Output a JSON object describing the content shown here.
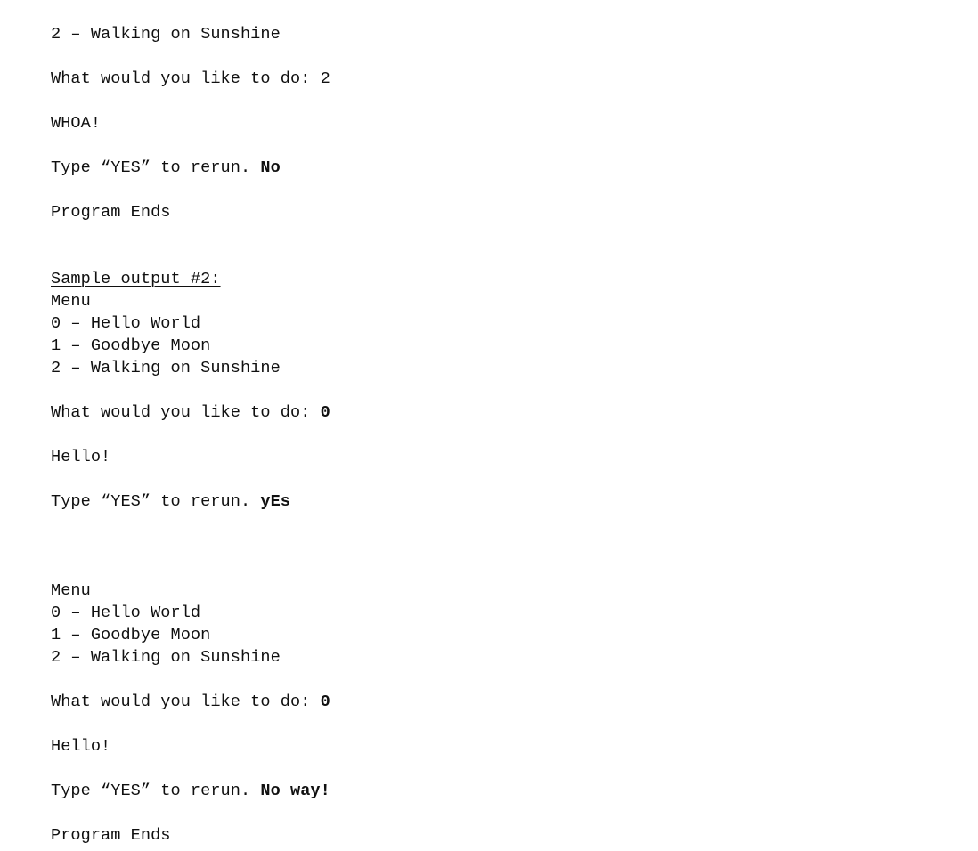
{
  "document": {
    "background_color": "#ffffff",
    "text_color": "#101010",
    "lines": {
      "menu1_item2": "2 – Walking on Sunshine",
      "prompt1_label": "What would you like to do: ",
      "prompt1_value": "2",
      "response1": "WHOA!",
      "rerun1_label": "Type “YES” to rerun. ",
      "rerun1_value": "No",
      "program_ends_1": "Program Ends",
      "sample2_heading": "Sample output #2:",
      "menu2_title": "Menu",
      "menu2_item0": "0 – Hello World",
      "menu2_item1": "1 – Goodbye Moon",
      "menu2_item2": "2 – Walking on Sunshine",
      "prompt2_label": "What would you like to do: ",
      "prompt2_value": "0",
      "response2": "Hello!",
      "rerun2_label": "Type “YES” to rerun. ",
      "rerun2_value": "yEs",
      "menu3_title": "Menu",
      "menu3_item0": "0 – Hello World",
      "menu3_item1": "1 – Goodbye Moon",
      "menu3_item2": "2 – Walking on Sunshine",
      "prompt3_label": "What would you like to do: ",
      "prompt3_value": "0",
      "response3": "Hello!",
      "rerun3_label": "Type “YES” to rerun. ",
      "rerun3_value": "No way!",
      "program_ends_2": "Program Ends"
    }
  }
}
